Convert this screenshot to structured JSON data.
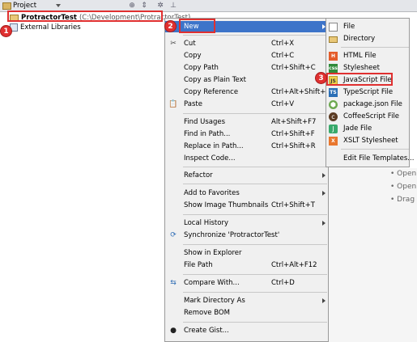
{
  "project_panel": {
    "tab_label": "Project",
    "toolbar_icons": [
      "sync-icon",
      "collapse-icon",
      "settings-icon",
      "hide-icon"
    ],
    "root": {
      "name": "ProtractorTest",
      "path": "(C:\\Development\\ProtractorTest)"
    },
    "external_libraries": "External Libraries"
  },
  "background_bullets": [
    "Open",
    "Open",
    "Drag"
  ],
  "context_menu": {
    "items": [
      {
        "label": "New",
        "shortcut": "",
        "submenu": true,
        "icon": "",
        "selected": true
      },
      {
        "label": "Cut",
        "shortcut": "Ctrl+X",
        "icon": "scissors-icon"
      },
      {
        "label": "Copy",
        "shortcut": "Ctrl+C",
        "icon": ""
      },
      {
        "label": "Copy Path",
        "shortcut": "Ctrl+Shift+C",
        "icon": ""
      },
      {
        "label": "Copy as Plain Text",
        "shortcut": "",
        "icon": ""
      },
      {
        "label": "Copy Reference",
        "shortcut": "Ctrl+Alt+Shift+C",
        "icon": ""
      },
      {
        "label": "Paste",
        "shortcut": "Ctrl+V",
        "icon": "clipboard-icon"
      },
      {
        "label": "Find Usages",
        "shortcut": "Alt+Shift+F7",
        "icon": ""
      },
      {
        "label": "Find in Path...",
        "shortcut": "Ctrl+Shift+F",
        "icon": ""
      },
      {
        "label": "Replace in Path...",
        "shortcut": "Ctrl+Shift+R",
        "icon": ""
      },
      {
        "label": "Inspect Code...",
        "shortcut": "",
        "icon": ""
      },
      {
        "label": "Refactor",
        "shortcut": "",
        "submenu": true,
        "icon": ""
      },
      {
        "label": "Add to Favorites",
        "shortcut": "",
        "submenu": true,
        "icon": ""
      },
      {
        "label": "Show Image Thumbnails",
        "shortcut": "Ctrl+Shift+T",
        "icon": ""
      },
      {
        "label": "Local History",
        "shortcut": "",
        "submenu": true,
        "icon": ""
      },
      {
        "label": "Synchronize 'ProtractorTest'",
        "shortcut": "",
        "icon": "sync-icon"
      },
      {
        "label": "Show in Explorer",
        "shortcut": "",
        "icon": ""
      },
      {
        "label": "File Path",
        "shortcut": "Ctrl+Alt+F12",
        "icon": ""
      },
      {
        "label": "Compare With...",
        "shortcut": "Ctrl+D",
        "icon": "compare-icon"
      },
      {
        "label": "Mark Directory As",
        "shortcut": "",
        "submenu": true,
        "icon": ""
      },
      {
        "label": "Remove BOM",
        "shortcut": "",
        "icon": ""
      },
      {
        "label": "Create Gist...",
        "shortcut": "",
        "icon": "github-icon"
      }
    ]
  },
  "new_submenu": {
    "items": [
      {
        "label": "File",
        "icon": "file-icon",
        "glyph": ""
      },
      {
        "label": "Directory",
        "icon": "folder-icon",
        "glyph": ""
      },
      {
        "label": "HTML File",
        "icon": "html-file-icon",
        "glyph": "H"
      },
      {
        "label": "Stylesheet",
        "icon": "css-file-icon",
        "glyph": "css"
      },
      {
        "label": "JavaScript File",
        "icon": "js-file-icon",
        "glyph": "JS"
      },
      {
        "label": "TypeScript File",
        "icon": "ts-file-icon",
        "glyph": "TS"
      },
      {
        "label": "package.json File",
        "icon": "package-json-icon",
        "glyph": "⬢"
      },
      {
        "label": "CoffeeScript File",
        "icon": "coffeescript-icon",
        "glyph": "c"
      },
      {
        "label": "Jade File",
        "icon": "jade-icon",
        "glyph": "J"
      },
      {
        "label": "XSLT Stylesheet",
        "icon": "xslt-icon",
        "glyph": "X"
      },
      {
        "label": "Edit File Templates...",
        "icon": "",
        "glyph": ""
      }
    ]
  },
  "callouts": [
    "1",
    "2",
    "3"
  ],
  "colors": {
    "selection": "#3d74c9",
    "annotation": "#e03030"
  }
}
